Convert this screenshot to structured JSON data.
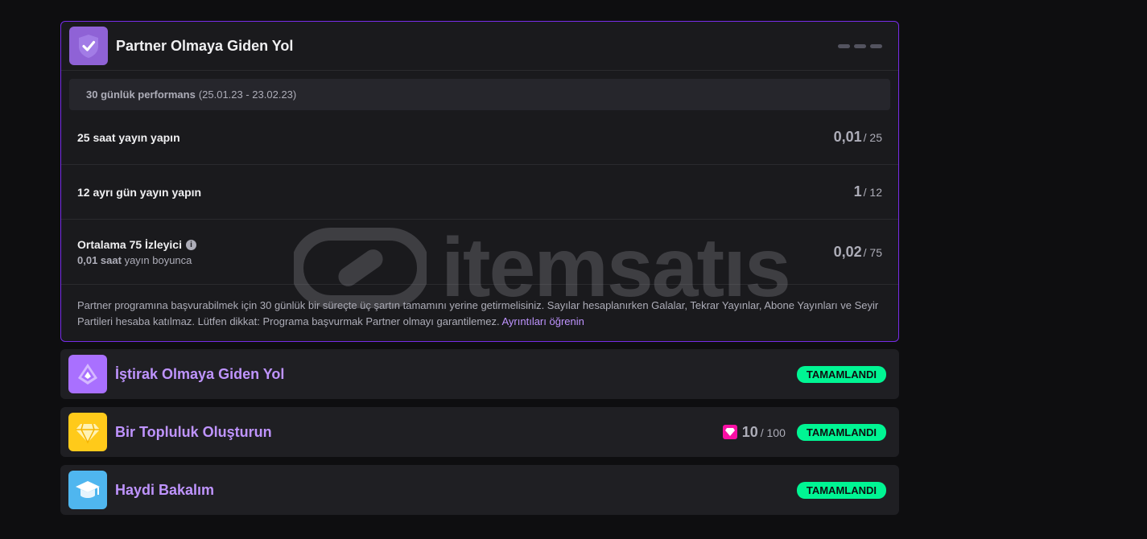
{
  "partner": {
    "title": "Partner Olmaya Giden Yol",
    "performance": {
      "label": "30 günlük performans",
      "range": "(25.01.23 - 23.02.23)"
    },
    "requirements": [
      {
        "label": "25 saat yayın yapın",
        "current": "0,01",
        "target": "/ 25"
      },
      {
        "label": "12 ayrı gün yayın yapın",
        "current": "1",
        "target": "/ 12"
      },
      {
        "label": "Ortalama 75 İzleyici",
        "sub_value": "0,01 saat",
        "sub_text": "yayın boyunca",
        "current": "0,02",
        "target": "/ 75"
      }
    ],
    "footnote": "Partner programına başvurabilmek için 30 günlük bir süreçte üç şartın tamamını yerine getirmelisiniz. Sayılar hesaplanırken Galalar, Tekrar Yayınlar, Abone Yayınları ve Seyir Partileri hesaba katılmaz. Lütfen dikkat: Programa başvurmak Partner olmayı garantilemez.",
    "learn_more": "Ayrıntıları öğrenin"
  },
  "affiliate": {
    "title": "İştirak Olmaya Giden Yol",
    "status": "TAMAMLANDI"
  },
  "community": {
    "title": "Bir Topluluk Oluşturun",
    "current": "10",
    "target": "/ 100",
    "status": "TAMAMLANDI"
  },
  "getting_started": {
    "title": "Haydi Bakalım",
    "status": "TAMAMLANDI"
  },
  "watermark": {
    "text": "itemsatıs"
  },
  "colors": {
    "accent": "#772ce8",
    "purple_text": "#bf94ff",
    "success": "#00f593",
    "gem": "#f90fa4"
  },
  "icons": {
    "partner": "checkmark-badge-icon",
    "affiliate": "affiliate-emblem-icon",
    "community": "diamond-icon",
    "getting_started": "graduation-cap-icon"
  }
}
